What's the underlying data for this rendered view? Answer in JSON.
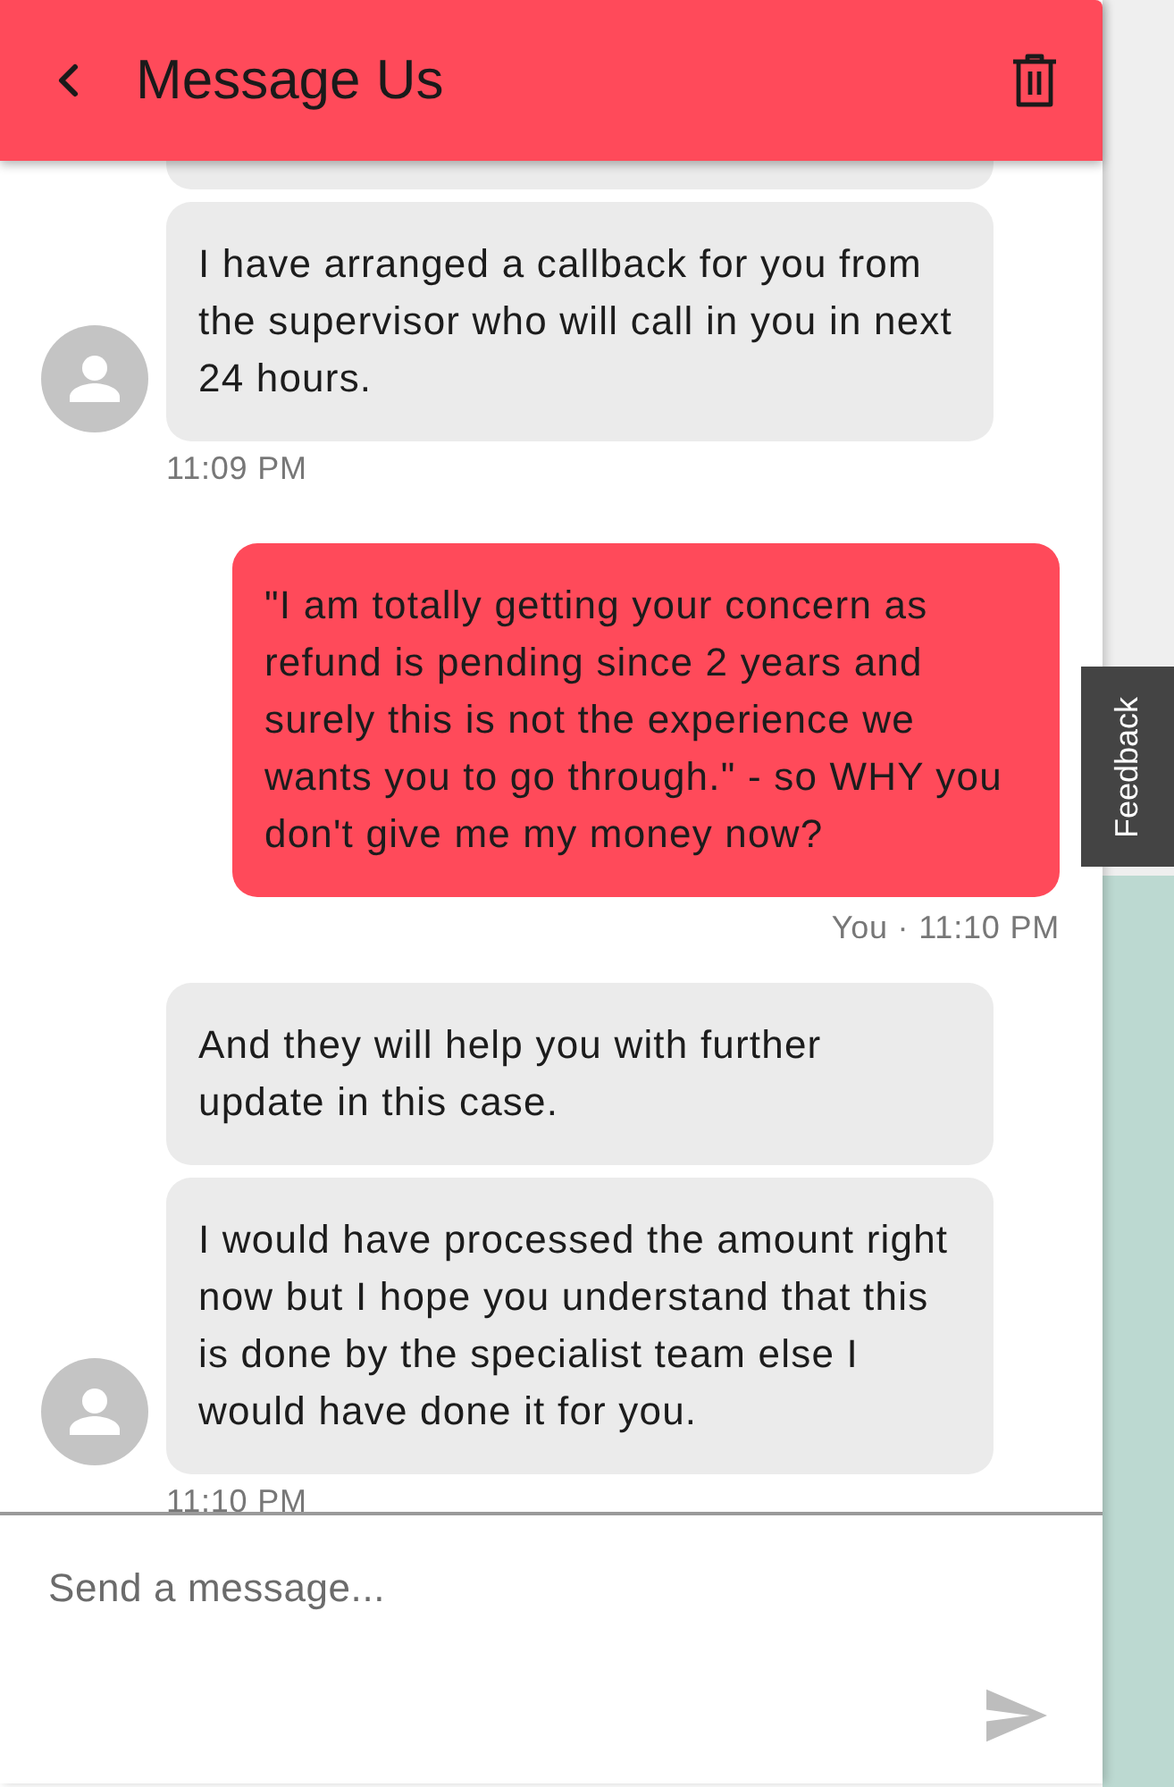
{
  "header": {
    "title": "Message Us"
  },
  "messages": [
    {
      "kind": "agent",
      "bubbles": [
        "I have arranged a callback for you from the supervisor who will call in you in next 24 hours."
      ],
      "timestamp": "11:09 PM"
    },
    {
      "kind": "user",
      "bubbles": [
        "\"I am totally getting your concern as refund is pending since 2 years and surely this is not the experience we wants you to go through.\" - so WHY you don't give me my money now?"
      ],
      "timestamp": "You · 11:10 PM"
    },
    {
      "kind": "agent",
      "bubbles": [
        "And they will help you with further update in this case.",
        "I would have processed the amount right now but I hope you understand that this is done by the specialist team else I would have done it for you."
      ],
      "timestamp": "11:10 PM"
    }
  ],
  "feedback_tab": {
    "label": "Feedback"
  },
  "composer": {
    "placeholder": "Send a message..."
  }
}
